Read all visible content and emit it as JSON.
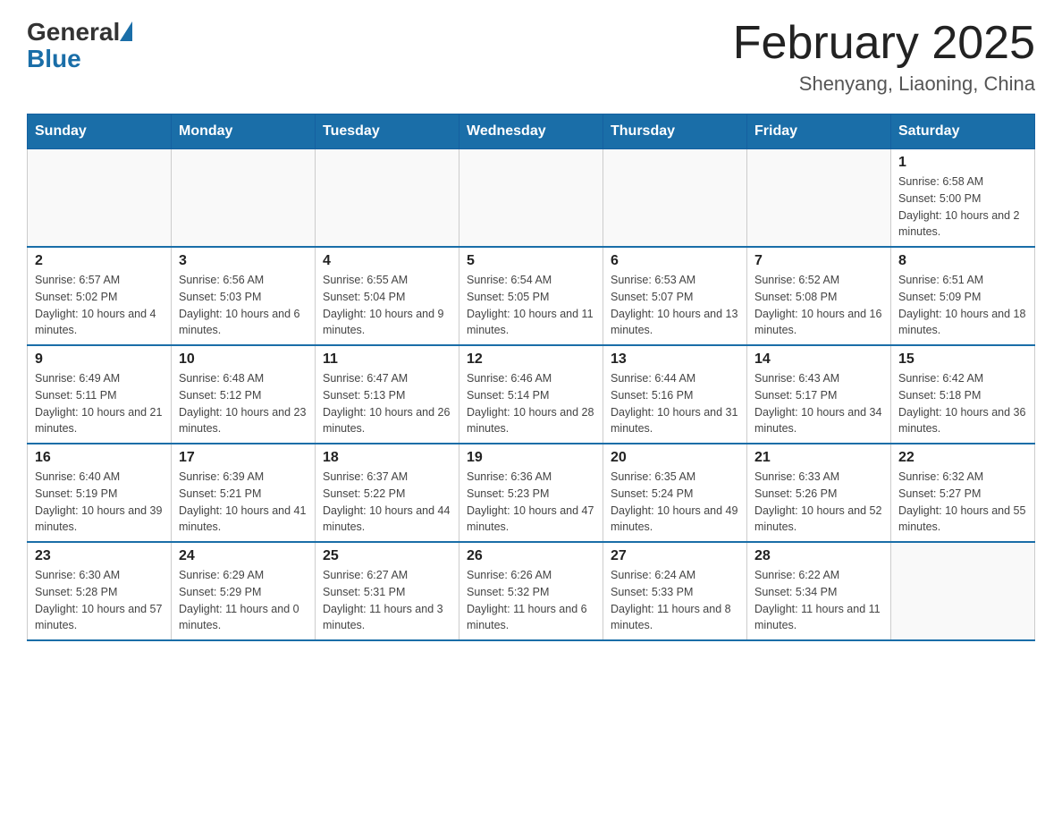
{
  "header": {
    "logo": {
      "general": "General",
      "triangle": "",
      "blue": "Blue"
    },
    "title": "February 2025",
    "subtitle": "Shenyang, Liaoning, China"
  },
  "weekdays": [
    "Sunday",
    "Monday",
    "Tuesday",
    "Wednesday",
    "Thursday",
    "Friday",
    "Saturday"
  ],
  "weeks": [
    [
      {
        "day": "",
        "info": ""
      },
      {
        "day": "",
        "info": ""
      },
      {
        "day": "",
        "info": ""
      },
      {
        "day": "",
        "info": ""
      },
      {
        "day": "",
        "info": ""
      },
      {
        "day": "",
        "info": ""
      },
      {
        "day": "1",
        "info": "Sunrise: 6:58 AM\nSunset: 5:00 PM\nDaylight: 10 hours and 2 minutes."
      }
    ],
    [
      {
        "day": "2",
        "info": "Sunrise: 6:57 AM\nSunset: 5:02 PM\nDaylight: 10 hours and 4 minutes."
      },
      {
        "day": "3",
        "info": "Sunrise: 6:56 AM\nSunset: 5:03 PM\nDaylight: 10 hours and 6 minutes."
      },
      {
        "day": "4",
        "info": "Sunrise: 6:55 AM\nSunset: 5:04 PM\nDaylight: 10 hours and 9 minutes."
      },
      {
        "day": "5",
        "info": "Sunrise: 6:54 AM\nSunset: 5:05 PM\nDaylight: 10 hours and 11 minutes."
      },
      {
        "day": "6",
        "info": "Sunrise: 6:53 AM\nSunset: 5:07 PM\nDaylight: 10 hours and 13 minutes."
      },
      {
        "day": "7",
        "info": "Sunrise: 6:52 AM\nSunset: 5:08 PM\nDaylight: 10 hours and 16 minutes."
      },
      {
        "day": "8",
        "info": "Sunrise: 6:51 AM\nSunset: 5:09 PM\nDaylight: 10 hours and 18 minutes."
      }
    ],
    [
      {
        "day": "9",
        "info": "Sunrise: 6:49 AM\nSunset: 5:11 PM\nDaylight: 10 hours and 21 minutes."
      },
      {
        "day": "10",
        "info": "Sunrise: 6:48 AM\nSunset: 5:12 PM\nDaylight: 10 hours and 23 minutes."
      },
      {
        "day": "11",
        "info": "Sunrise: 6:47 AM\nSunset: 5:13 PM\nDaylight: 10 hours and 26 minutes."
      },
      {
        "day": "12",
        "info": "Sunrise: 6:46 AM\nSunset: 5:14 PM\nDaylight: 10 hours and 28 minutes."
      },
      {
        "day": "13",
        "info": "Sunrise: 6:44 AM\nSunset: 5:16 PM\nDaylight: 10 hours and 31 minutes."
      },
      {
        "day": "14",
        "info": "Sunrise: 6:43 AM\nSunset: 5:17 PM\nDaylight: 10 hours and 34 minutes."
      },
      {
        "day": "15",
        "info": "Sunrise: 6:42 AM\nSunset: 5:18 PM\nDaylight: 10 hours and 36 minutes."
      }
    ],
    [
      {
        "day": "16",
        "info": "Sunrise: 6:40 AM\nSunset: 5:19 PM\nDaylight: 10 hours and 39 minutes."
      },
      {
        "day": "17",
        "info": "Sunrise: 6:39 AM\nSunset: 5:21 PM\nDaylight: 10 hours and 41 minutes."
      },
      {
        "day": "18",
        "info": "Sunrise: 6:37 AM\nSunset: 5:22 PM\nDaylight: 10 hours and 44 minutes."
      },
      {
        "day": "19",
        "info": "Sunrise: 6:36 AM\nSunset: 5:23 PM\nDaylight: 10 hours and 47 minutes."
      },
      {
        "day": "20",
        "info": "Sunrise: 6:35 AM\nSunset: 5:24 PM\nDaylight: 10 hours and 49 minutes."
      },
      {
        "day": "21",
        "info": "Sunrise: 6:33 AM\nSunset: 5:26 PM\nDaylight: 10 hours and 52 minutes."
      },
      {
        "day": "22",
        "info": "Sunrise: 6:32 AM\nSunset: 5:27 PM\nDaylight: 10 hours and 55 minutes."
      }
    ],
    [
      {
        "day": "23",
        "info": "Sunrise: 6:30 AM\nSunset: 5:28 PM\nDaylight: 10 hours and 57 minutes."
      },
      {
        "day": "24",
        "info": "Sunrise: 6:29 AM\nSunset: 5:29 PM\nDaylight: 11 hours and 0 minutes."
      },
      {
        "day": "25",
        "info": "Sunrise: 6:27 AM\nSunset: 5:31 PM\nDaylight: 11 hours and 3 minutes."
      },
      {
        "day": "26",
        "info": "Sunrise: 6:26 AM\nSunset: 5:32 PM\nDaylight: 11 hours and 6 minutes."
      },
      {
        "day": "27",
        "info": "Sunrise: 6:24 AM\nSunset: 5:33 PM\nDaylight: 11 hours and 8 minutes."
      },
      {
        "day": "28",
        "info": "Sunrise: 6:22 AM\nSunset: 5:34 PM\nDaylight: 11 hours and 11 minutes."
      },
      {
        "day": "",
        "info": ""
      }
    ]
  ]
}
